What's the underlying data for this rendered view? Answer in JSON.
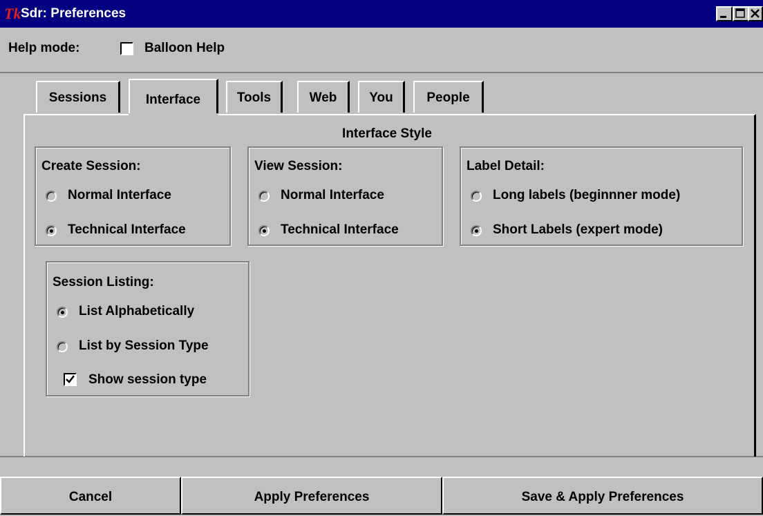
{
  "window": {
    "title": "Sdr: Preferences",
    "logo_text": "Tk"
  },
  "help_mode": {
    "label": "Help mode:",
    "balloon_label": "Balloon Help",
    "balloon_checked": false
  },
  "tabs": [
    {
      "label": "Sessions",
      "active": false
    },
    {
      "label": "Interface",
      "active": true
    },
    {
      "label": "Tools",
      "active": false
    },
    {
      "label": "Web",
      "active": false
    },
    {
      "label": "You",
      "active": false
    },
    {
      "label": "People",
      "active": false
    }
  ],
  "interface_style": {
    "title": "Interface Style",
    "create_session": {
      "label": "Create Session:",
      "options": [
        "Normal Interface",
        "Technical Interface"
      ],
      "selected": 1
    },
    "view_session": {
      "label": "View Session:",
      "options": [
        "Normal Interface",
        "Technical Interface"
      ],
      "selected": 1
    },
    "label_detail": {
      "label": "Label Detail:",
      "options": [
        "Long labels (beginnner mode)",
        "Short Labels (expert mode)"
      ],
      "selected": 1
    },
    "session_listing": {
      "label": "Session Listing:",
      "options": [
        "List Alphabetically",
        "List by Session Type"
      ],
      "selected": 0,
      "show_type_label": "Show session type",
      "show_type_checked": true
    }
  },
  "buttons": {
    "cancel": "Cancel",
    "apply": "Apply Preferences",
    "save_apply": "Save & Apply Preferences"
  }
}
